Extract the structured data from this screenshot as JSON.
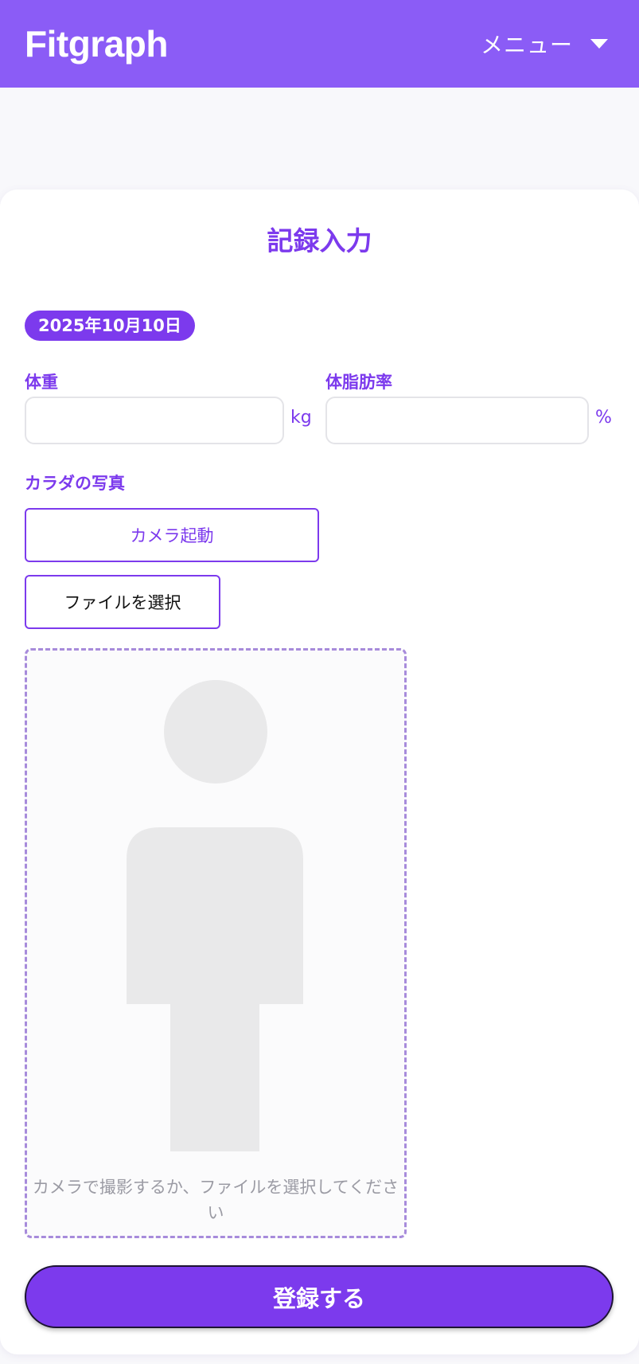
{
  "header": {
    "brand": "Fitgraph",
    "menu_label": "メニュー",
    "menu_icon": "chevron-down-icon"
  },
  "form": {
    "title": "記録入力",
    "date": "2025年10月10日",
    "weight": {
      "label": "体重",
      "value": "",
      "unit": "kg"
    },
    "body_fat": {
      "label": "体脂肪率",
      "value": "",
      "unit": "%"
    },
    "photo": {
      "label": "カラダの写真",
      "camera_button": "カメラ起動",
      "file_button": "ファイルを選択",
      "hint": "カメラで撮影するか、ファイルを選択してください",
      "placeholder_icon": "person-silhouette-icon"
    },
    "submit_label": "登録する"
  },
  "colors": {
    "header_bg": "#8b5cf6",
    "accent": "#7c3aed",
    "dashed_border": "#a78bdb",
    "placeholder": "#e9e9ea",
    "hint_text": "#9b9ba4"
  }
}
